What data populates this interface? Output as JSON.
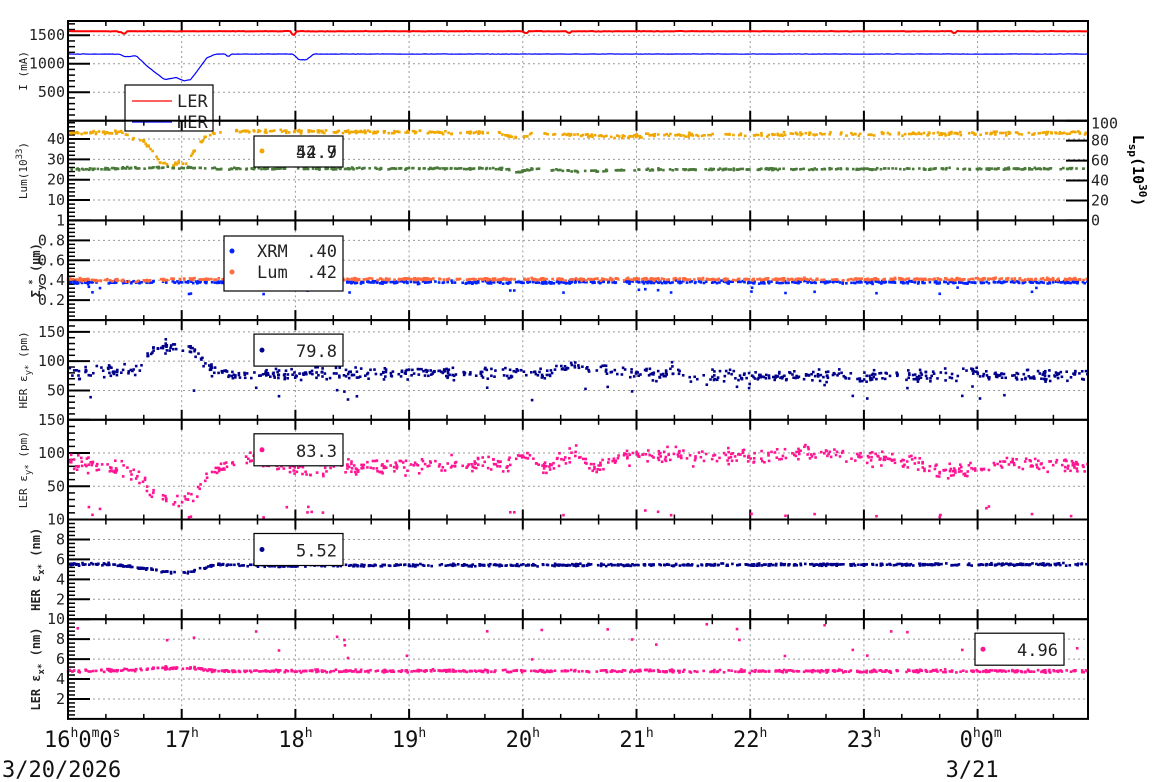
{
  "chart_data": {
    "type": "scatter",
    "x_range_hours_from_start": [
      0,
      8.97
    ],
    "x_ticks": [
      {
        "t": 0,
        "main": "16",
        "parts": [
          [
            "h",
            "0"
          ],
          [
            "m",
            "0"
          ],
          [
            "s",
            ""
          ]
        ]
      },
      {
        "t": 1,
        "main": "17",
        "parts": [
          [
            "h",
            ""
          ]
        ]
      },
      {
        "t": 2,
        "main": "18",
        "parts": [
          [
            "h",
            ""
          ]
        ]
      },
      {
        "t": 3,
        "main": "19",
        "parts": [
          [
            "h",
            ""
          ]
        ]
      },
      {
        "t": 4,
        "main": "20",
        "parts": [
          [
            "h",
            ""
          ]
        ]
      },
      {
        "t": 5,
        "main": "21",
        "parts": [
          [
            "h",
            ""
          ]
        ]
      },
      {
        "t": 6,
        "main": "22",
        "parts": [
          [
            "h",
            ""
          ]
        ]
      },
      {
        "t": 7,
        "main": "23",
        "parts": [
          [
            "h",
            ""
          ]
        ]
      },
      {
        "t": 8,
        "main": "0",
        "parts": [
          [
            "h",
            "0"
          ],
          [
            "m",
            ""
          ]
        ]
      }
    ],
    "date_labels": [
      {
        "t": 0,
        "text": "3/20/2026"
      },
      {
        "t": 8,
        "text": "3/21"
      }
    ],
    "panels": [
      {
        "id": "current",
        "ylabel": "I (mA)",
        "ylim": [
          0,
          1750
        ],
        "yticks": [
          500,
          1000,
          1500
        ],
        "series": [
          {
            "name": "LER",
            "color": "#ff0000",
            "kind": "line",
            "noise": 4,
            "points": [
              [
                0,
                1570
              ],
              [
                9,
                1570
              ]
            ],
            "spikes": [
              [
                0.45,
                -15
              ],
              [
                0.5,
                -40
              ],
              [
                1.99,
                -60
              ],
              [
                4.02,
                -30
              ],
              [
                4.4,
                -25
              ],
              [
                7.8,
                -30
              ]
            ]
          },
          {
            "name": "HER",
            "color": "#0000ff",
            "kind": "line",
            "noise": 3,
            "points": [
              [
                0,
                1170
              ],
              [
                0.45,
                1170
              ],
              [
                0.5,
                1120
              ],
              [
                0.6,
                1140
              ],
              [
                0.7,
                950
              ],
              [
                0.85,
                720
              ],
              [
                0.95,
                760
              ],
              [
                1.02,
                700
              ],
              [
                1.08,
                720
              ],
              [
                1.22,
                1100
              ],
              [
                1.3,
                1170
              ],
              [
                1.38,
                1170
              ],
              [
                1.41,
                1120
              ],
              [
                1.44,
                1170
              ],
              [
                1.98,
                1170
              ],
              [
                2.03,
                1070
              ],
              [
                2.1,
                1070
              ],
              [
                2.16,
                1170
              ],
              [
                9,
                1170
              ]
            ]
          }
        ],
        "legend": {
          "items": [
            {
              "label": "LER",
              "color": "#ff0000"
            },
            {
              "label": "HER",
              "color": "#0000ff"
            }
          ]
        }
      },
      {
        "id": "lum",
        "ylabel": "Lum(10",
        "ylabel_sup": "33",
        "ylabel_end": ")",
        "ylim": [
          0,
          49
        ],
        "yticks": [
          10,
          20,
          30,
          40
        ],
        "right_axis": {
          "label": "L",
          "label_sub": "sp",
          "label_mid": "(10",
          "label_sup": "30",
          "label_end": ")",
          "ylim": [
            0,
            100
          ],
          "yticks": [
            0,
            20,
            40,
            60,
            80,
            100
          ]
        },
        "series": [
          {
            "name": "Lum",
            "color": "#f0a800",
            "kind": "dots",
            "noise": 0.7,
            "axis": "left",
            "points": [
              [
                0,
                43
              ],
              [
                0.5,
                43
              ],
              [
                0.55,
                40
              ],
              [
                0.62,
                41
              ],
              [
                0.72,
                36
              ],
              [
                0.82,
                28
              ],
              [
                0.92,
                27
              ],
              [
                0.97,
                29
              ],
              [
                1.03,
                27
              ],
              [
                1.12,
                35
              ],
              [
                1.22,
                42
              ],
              [
                1.4,
                44
              ],
              [
                3.8,
                43
              ],
              [
                3.95,
                40
              ],
              [
                4.1,
                43
              ],
              [
                4.8,
                41
              ],
              [
                5.2,
                42
              ],
              [
                9,
                43
              ]
            ]
          },
          {
            "name": "Lsp",
            "color": "#4a7a3a",
            "kind": "dots",
            "noise": 0.8,
            "axis": "right",
            "points": [
              [
                0,
                51
              ],
              [
                0.8,
                53
              ],
              [
                1.0,
                53
              ],
              [
                1.3,
                52
              ],
              [
                3.85,
                52
              ],
              [
                3.95,
                48
              ],
              [
                4.1,
                52
              ],
              [
                4.5,
                49
              ],
              [
                5,
                51
              ],
              [
                9,
                52
              ]
            ]
          }
        ],
        "legend": {
          "values": [
            "52.7",
            "44.9"
          ],
          "color": "#f0a800"
        }
      },
      {
        "id": "sigma",
        "ylabel": "Σ",
        "ylabel_sub": "y",
        "ylabel_sup": "*",
        "ylabel_end": " (μm)",
        "ylim": [
          0,
          1
        ],
        "yticks": [
          0.2,
          0.4,
          0.6,
          0.8,
          1
        ],
        "ytick_labels": [
          "0.2",
          "0.4",
          "0.6",
          "0.8",
          "1"
        ],
        "series": [
          {
            "name": "XRM",
            "color": "#0022ff",
            "kind": "dots",
            "noise": 0.012,
            "outliers": 0.04,
            "outlier_range": [
              0.26,
              0.34
            ],
            "points": [
              [
                0,
                0.38
              ],
              [
                9,
                0.38
              ]
            ]
          },
          {
            "name": "Lum",
            "color": "#ff6a3d",
            "kind": "dots",
            "noise": 0.01,
            "points": [
              [
                0,
                0.41
              ],
              [
                0.6,
                0.39
              ],
              [
                0.9,
                0.41
              ],
              [
                9,
                0.41
              ]
            ]
          }
        ],
        "legend": {
          "items": [
            {
              "label": "XRM",
              "value": ".40",
              "color": "#0022ff"
            },
            {
              "label": "Lum",
              "value": ".42",
              "color": "#ff6a3d"
            }
          ]
        }
      },
      {
        "id": "her_ey",
        "ylabel": "HER ε",
        "ylabel_sub": "y*",
        "ylabel_end": " (pm)",
        "ylim": [
          0,
          170
        ],
        "yticks": [
          50,
          100,
          150
        ],
        "series": [
          {
            "name": "HER εy*",
            "color": "#00008b",
            "kind": "dots",
            "noise": 9,
            "outliers": 0.03,
            "outlier_range": [
              30,
              60
            ],
            "points": [
              [
                0,
                80
              ],
              [
                0.6,
                85
              ],
              [
                0.72,
                115
              ],
              [
                0.9,
                127
              ],
              [
                1.1,
                120
              ],
              [
                1.25,
                85
              ],
              [
                1.4,
                78
              ],
              [
                4.2,
                80
              ],
              [
                4.5,
                92
              ],
              [
                4.8,
                85
              ],
              [
                5.0,
                78
              ],
              [
                5.2,
                76
              ],
              [
                5.3,
                88
              ],
              [
                5.5,
                75
              ],
              [
                7.8,
                75
              ],
              [
                7.9,
                88
              ],
              [
                8.1,
                75
              ],
              [
                9,
                78
              ]
            ]
          }
        ],
        "legend": {
          "value": "79.8",
          "color": "#00008b"
        }
      },
      {
        "id": "ler_ey",
        "ylabel": "LER ε",
        "ylabel_sub": "y*",
        "ylabel_end": " (pm)",
        "ylim": [
          0,
          150
        ],
        "yticks": [
          50,
          100,
          150
        ],
        "series": [
          {
            "name": "LER εy*",
            "color": "#ff1493",
            "kind": "dots",
            "noise": 10,
            "outliers": 0.04,
            "outlier_range": [
              3,
              20
            ],
            "points": [
              [
                0,
                88
              ],
              [
                0.2,
                85
              ],
              [
                0.5,
                72
              ],
              [
                0.62,
                65
              ],
              [
                0.75,
                35
              ],
              [
                1.0,
                27
              ],
              [
                1.1,
                35
              ],
              [
                1.25,
                70
              ],
              [
                1.4,
                85
              ],
              [
                1.8,
                88
              ],
              [
                2.0,
                72
              ],
              [
                2.5,
                80
              ],
              [
                3,
                80
              ],
              [
                3.5,
                85
              ],
              [
                3.9,
                85
              ],
              [
                4.0,
                100
              ],
              [
                4.2,
                80
              ],
              [
                4.45,
                100
              ],
              [
                4.6,
                78
              ],
              [
                4.8,
                90
              ],
              [
                5.0,
                95
              ],
              [
                5.5,
                95
              ],
              [
                6,
                95
              ],
              [
                6.5,
                100
              ],
              [
                7,
                95
              ],
              [
                7.5,
                85
              ],
              [
                7.7,
                72
              ],
              [
                8.2,
                85
              ],
              [
                9,
                80
              ]
            ]
          }
        ],
        "legend": {
          "value": "83.3",
          "color": "#ff1493"
        }
      },
      {
        "id": "her_ex",
        "ylabel": "HER ε",
        "ylabel_sub": "x*",
        "ylabel_end": " (nm)",
        "ylim": [
          0,
          10
        ],
        "yticks": [
          2,
          4,
          6,
          8,
          10
        ],
        "series": [
          {
            "name": "HER εx*",
            "color": "#00008b",
            "kind": "dots",
            "noise": 0.1,
            "points": [
              [
                0,
                5.5
              ],
              [
                0.4,
                5.5
              ],
              [
                0.9,
                4.7
              ],
              [
                1.05,
                4.7
              ],
              [
                1.3,
                5.5
              ],
              [
                2,
                5.3
              ],
              [
                2.1,
                5.4
              ],
              [
                9,
                5.5
              ]
            ]
          }
        ],
        "legend": {
          "value": "5.52",
          "color": "#00008b"
        }
      },
      {
        "id": "ler_ex",
        "ylabel": "LER ε",
        "ylabel_sub": "x*",
        "ylabel_end": " (nm)",
        "ylim": [
          0,
          10
        ],
        "yticks": [
          2,
          4,
          6,
          8,
          10
        ],
        "series": [
          {
            "name": "LER εx*",
            "color": "#ff1493",
            "kind": "dots",
            "noise": 0.12,
            "outliers": 0.03,
            "outlier_range": [
              5.5,
              9.5
            ],
            "points": [
              [
                0,
                4.8
              ],
              [
                0.6,
                4.9
              ],
              [
                0.8,
                5.1
              ],
              [
                1.1,
                5.1
              ],
              [
                1.3,
                4.8
              ],
              [
                9,
                4.8
              ]
            ]
          }
        ],
        "legend": {
          "value": "4.96",
          "color": "#ff1493"
        }
      }
    ]
  }
}
